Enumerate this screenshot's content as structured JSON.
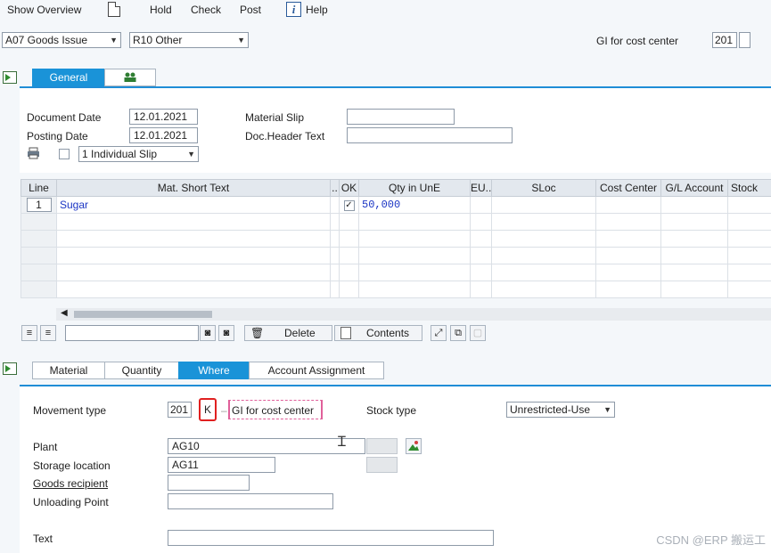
{
  "toolbar": {
    "show_overview": "Show Overview",
    "hold": "Hold",
    "check": "Check",
    "post": "Post",
    "help": "Help"
  },
  "header": {
    "transaction_select": "A07 Goods Issue",
    "reference_select": "R10 Other",
    "movement_desc": "GI for cost center",
    "movement_code": "201"
  },
  "top_tabs": {
    "general": "General"
  },
  "general": {
    "document_date_label": "Document Date",
    "document_date": "12.01.2021",
    "posting_date_label": "Posting Date",
    "posting_date": "12.01.2021",
    "material_slip_label": "Material Slip",
    "material_slip": "",
    "doc_header_text_label": "Doc.Header Text",
    "doc_header_text": "",
    "print_option": "1 Individual Slip"
  },
  "items_table": {
    "columns": [
      "Line",
      "Mat. Short Text",
      "..",
      "OK",
      "Qty in UnE",
      "EU..",
      "SLoc",
      "Cost Center",
      "G/L Account",
      "Stock"
    ],
    "rows": [
      {
        "line": "1",
        "text": "Sugar",
        "ok": "✓",
        "qty": "50,000"
      }
    ]
  },
  "table_toolbar": {
    "delete": "Delete",
    "contents": "Contents"
  },
  "detail_tabs": {
    "material": "Material",
    "quantity": "Quantity",
    "where": "Where",
    "account_assignment": "Account Assignment"
  },
  "where": {
    "movement_type_label": "Movement type",
    "movement_type": "201",
    "special_stock": "K",
    "movement_type_text": "GI for cost center",
    "stock_type_label": "Stock type",
    "stock_type": "Unrestricted-Use",
    "plant_label": "Plant",
    "plant": "AG10",
    "storage_location_label": "Storage location",
    "storage_location": "AG11",
    "goods_recipient_label": "Goods recipient",
    "goods_recipient": "",
    "unloading_point_label": "Unloading Point",
    "unloading_point": "",
    "text_label": "Text",
    "text": ""
  },
  "watermark": "CSDN @ERP 搬运工",
  "colors": {
    "accent": "#1a93d8",
    "highlight": "#e02020",
    "value_blue": "#1b35c4"
  }
}
